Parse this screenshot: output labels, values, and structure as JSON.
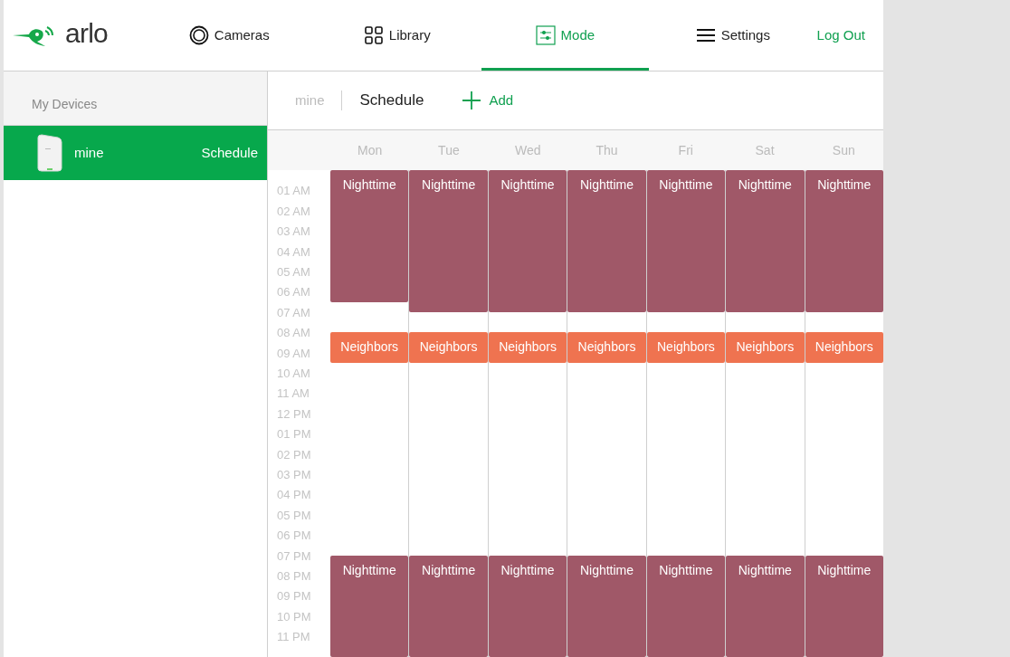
{
  "header": {
    "logo": "arlo",
    "nav": [
      {
        "label": "Cameras",
        "selected": false
      },
      {
        "label": "Library",
        "selected": false
      },
      {
        "label": "Mode",
        "selected": true
      },
      {
        "label": "Settings",
        "selected": false
      }
    ],
    "logout": "Log Out"
  },
  "sidebar": {
    "title": "My Devices",
    "devices": [
      {
        "name": "mine",
        "status": "Schedule",
        "selected": true
      }
    ]
  },
  "toolbar": {
    "breadcrumb": "mine",
    "title": "Schedule",
    "add": "Add"
  },
  "schedule": {
    "hours": [
      "01 AM",
      "02 AM",
      "03 AM",
      "04 AM",
      "05 AM",
      "06 AM",
      "07 AM",
      "08 AM",
      "09 AM",
      "10 AM",
      "11 AM",
      "12 PM",
      "01 PM",
      "02 PM",
      "03 PM",
      "04 PM",
      "05 PM",
      "06 PM",
      "07 PM",
      "08 PM",
      "09 PM",
      "10 PM",
      "11 PM"
    ],
    "days": [
      {
        "label": "Mon",
        "events": [
          {
            "label": "Nighttime",
            "color": "#a05868"
          },
          {
            "label": "Neighbors",
            "color": "#ef7350"
          },
          {
            "label": "Nighttime",
            "color": "#a05868"
          }
        ]
      },
      {
        "label": "Tue",
        "events": [
          {
            "label": "Nighttime",
            "color": "#a05868"
          },
          {
            "label": "Neighbors",
            "color": "#ef7350"
          },
          {
            "label": "Nighttime",
            "color": "#a05868"
          }
        ]
      },
      {
        "label": "Wed",
        "events": [
          {
            "label": "Nighttime",
            "color": "#a05868"
          },
          {
            "label": "Neighbors",
            "color": "#ef7350"
          },
          {
            "label": "Nighttime",
            "color": "#a05868"
          }
        ]
      },
      {
        "label": "Thu",
        "events": [
          {
            "label": "Nighttime",
            "color": "#a05868"
          },
          {
            "label": "Neighbors",
            "color": "#ef7350"
          },
          {
            "label": "Nighttime",
            "color": "#a05868"
          }
        ]
      },
      {
        "label": "Fri",
        "events": [
          {
            "label": "Nighttime",
            "color": "#a05868"
          },
          {
            "label": "Neighbors",
            "color": "#ef7350"
          },
          {
            "label": "Nighttime",
            "color": "#a05868"
          }
        ]
      },
      {
        "label": "Sat",
        "events": [
          {
            "label": "Nighttime",
            "color": "#a05868"
          },
          {
            "label": "Neighbors",
            "color": "#ef7350"
          },
          {
            "label": "Nighttime",
            "color": "#a05868"
          }
        ]
      },
      {
        "label": "Sun",
        "events": [
          {
            "label": "Nighttime",
            "color": "#a05868"
          },
          {
            "label": "Neighbors",
            "color": "#ef7350"
          },
          {
            "label": "Nighttime",
            "color": "#a05868"
          }
        ]
      }
    ]
  }
}
